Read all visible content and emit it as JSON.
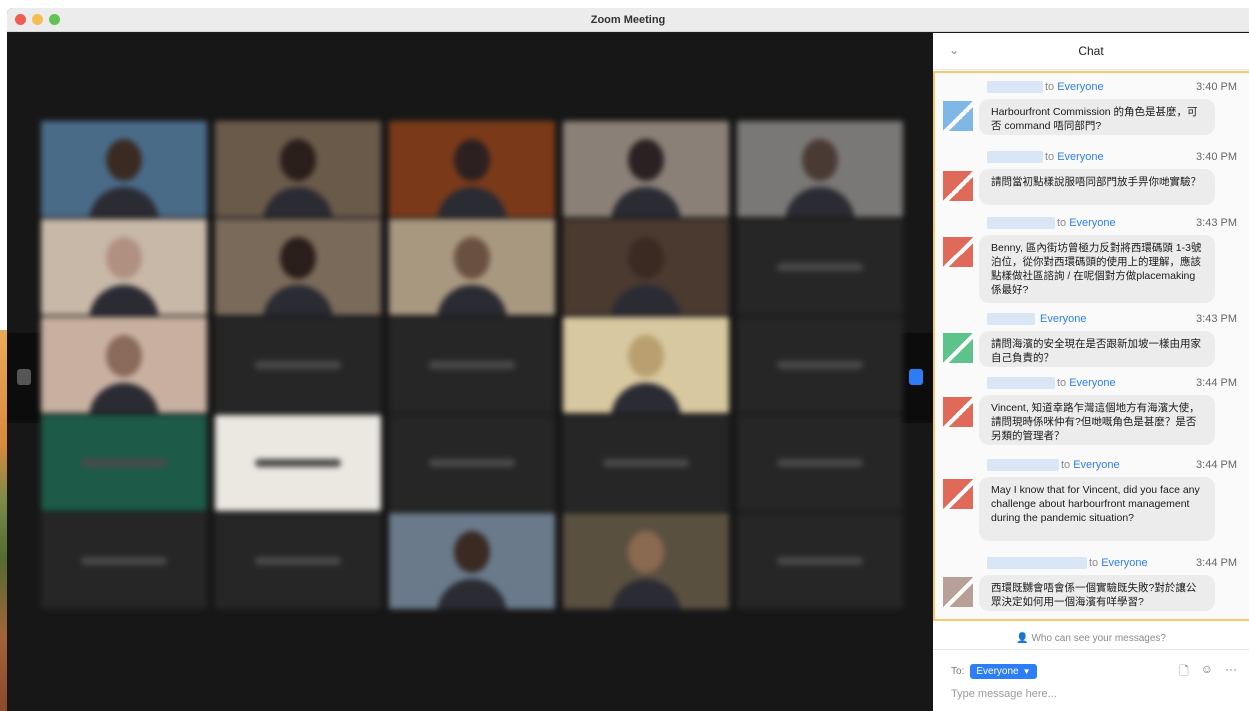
{
  "window": {
    "title": "Zoom Meeting",
    "traffic_lights": [
      "#ee5c54",
      "#f5bd4f",
      "#61c454"
    ]
  },
  "gallery": {
    "tiles": [
      {
        "label": "",
        "bg": "#4a6b88",
        "face": "#3a2a22"
      },
      {
        "label": "",
        "bg": "#6a5a4a",
        "face": "#2a1e1a"
      },
      {
        "label": "",
        "bg": "#7a3a1a",
        "face": "#2c2020"
      },
      {
        "label": "",
        "bg": "#8a8078",
        "face": "#2a2222"
      },
      {
        "label": "",
        "bg": "#7a7876",
        "face": "#4a3a34"
      },
      {
        "label": "",
        "bg": "#c8b8a8",
        "face": "#b09080"
      },
      {
        "label": "",
        "bg": "#7a6a5a",
        "face": "#2a1e1a"
      },
      {
        "label": "",
        "bg": "#a89880",
        "face": "#6a5040"
      },
      {
        "label": "",
        "bg": "#4a3a30",
        "face": "#3a2a22"
      },
      {
        "label": "",
        "bg": "#262626",
        "face": ""
      },
      {
        "label": "",
        "bg": "#c8b0a0",
        "face": "#8a6a5a"
      },
      {
        "label": "",
        "bg": "#262626",
        "face": ""
      },
      {
        "label": "",
        "bg": "#262626",
        "face": ""
      },
      {
        "label": "",
        "bg": "#d8c8a0",
        "face": "#b8a070"
      },
      {
        "label": "",
        "bg": "#262626",
        "face": ""
      },
      {
        "label": "",
        "bg": "#1e5a48",
        "face": ""
      },
      {
        "label": "",
        "bg": "#eae8e0",
        "face": ""
      },
      {
        "label": "",
        "bg": "#262626",
        "face": ""
      },
      {
        "label": "",
        "bg": "#262626",
        "face": ""
      },
      {
        "label": "",
        "bg": "#262626",
        "face": ""
      },
      {
        "label": "",
        "bg": "#262626",
        "face": ""
      },
      {
        "label": "",
        "bg": "#262626",
        "face": ""
      },
      {
        "label": "",
        "bg": "#6a7a8a",
        "face": "#3a2a22"
      },
      {
        "label": "",
        "bg": "#5a5040",
        "face": "#8a6a50"
      },
      {
        "label": "",
        "bg": "#262626",
        "face": ""
      }
    ]
  },
  "chat": {
    "title": "Chat",
    "accent": "#2d7ef6",
    "messages": [
      {
        "to": "to",
        "recipient": "Everyone",
        "time": "3:40 PM",
        "avatar": "#7fb8e6",
        "text": "Harbourfront Commission 的角色是甚麼，可否 command 唔同部門?"
      },
      {
        "to": "to",
        "recipient": "Everyone",
        "time": "3:40 PM",
        "avatar": "#e06a5a",
        "text": "請問當初點樣說服唔同部門放手畀你哋實驗？"
      },
      {
        "to": "to",
        "recipient": "Everyone",
        "time": "3:43 PM",
        "avatar": "#e06a5a",
        "text": "Benny, 區內街坊曾極力反對將西環碼頭 1-3號泊位，從你對西環碼頭的使用上的理解，應該點樣做社區諮詢 / 在呢個對方做placemaking係最好?"
      },
      {
        "to": "",
        "recipient": "Everyone",
        "time": "3:43 PM",
        "avatar": "#5cc48a",
        "text": "請問海濱的安全現在是否跟新加坡一樣由用家自己負責的？"
      },
      {
        "to": "to",
        "recipient": "Everyone",
        "time": "3:44 PM",
        "avatar": "#e06a5a",
        "text": "Vincent, 知道幸路乍灣這個地方有海濱大使，請問現時係咪仲有?但哋嘅角色是甚麼？是否另類的管理者？"
      },
      {
        "to": "to",
        "recipient": "Everyone",
        "time": "3:44 PM",
        "avatar": "#e06a5a",
        "text": "May I know that for Vincent, did you face any challenge about harbourfront management during the pandemic situation?"
      },
      {
        "to": "to",
        "recipient": "Everyone",
        "time": "3:44 PM",
        "avatar": "#b8a098",
        "text": "西環既嬲會唔會係一個實驗既失敗?對於讓公眾決定如何用一個海濱有咩學習?"
      }
    ],
    "who_can_see": "Who can see your messages?",
    "compose": {
      "to_label": "To:",
      "recipient": "Everyone",
      "placeholder": "Type message here..."
    }
  }
}
